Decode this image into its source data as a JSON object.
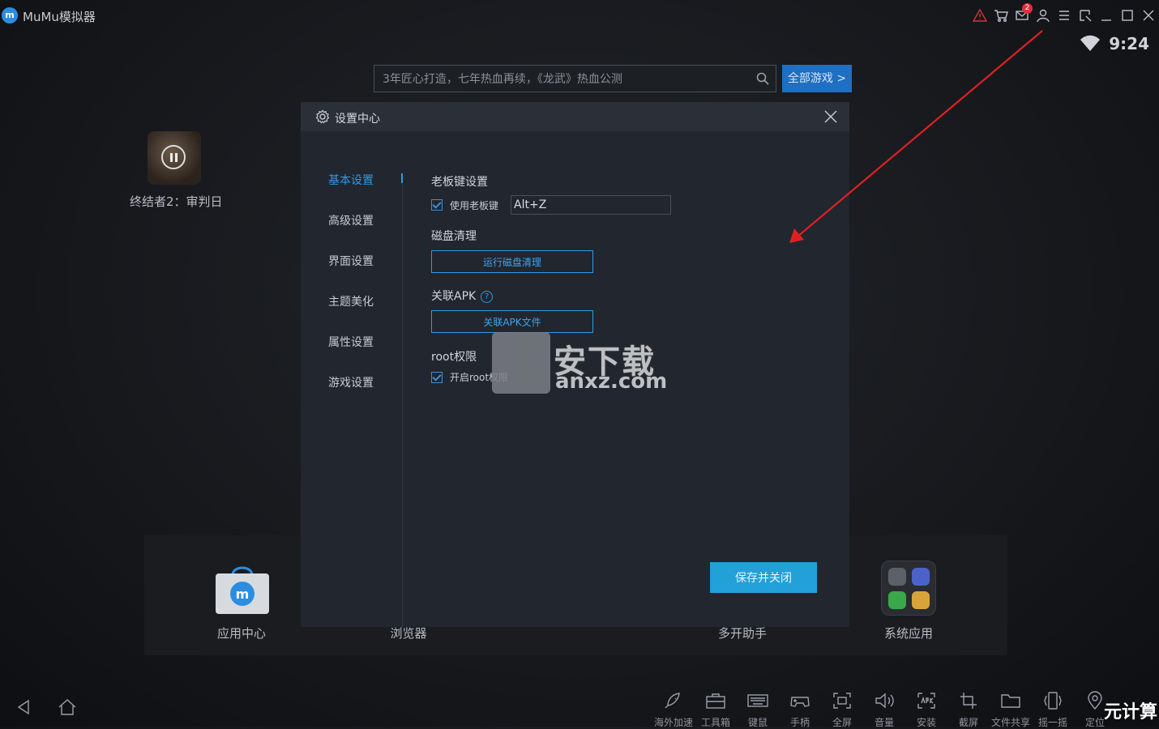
{
  "app": {
    "title": "MuMu模拟器",
    "logo_text": "m"
  },
  "titlebar": {
    "notification_count": "2"
  },
  "status": {
    "time": "9:24"
  },
  "search": {
    "placeholder": "3年匠心打造，七年热血再续，《龙武》热血公测",
    "all_games_label": "全部游戏 >"
  },
  "desktop": {
    "game_label": "终结者2：审判日"
  },
  "dock": {
    "items": [
      {
        "label": "应用中心"
      },
      {
        "label": "浏览器"
      },
      {
        "label": "多开助手"
      },
      {
        "label": "系统应用"
      }
    ]
  },
  "modal": {
    "title": "设置中心",
    "nav": [
      "基本设置",
      "高级设置",
      "界面设置",
      "主题美化",
      "属性设置",
      "游戏设置"
    ],
    "active_nav": "基本设置",
    "boss_key": {
      "title": "老板键设置",
      "checkbox_label": "使用老板键",
      "value": "Alt+Z"
    },
    "disk": {
      "title": "磁盘清理",
      "button": "运行磁盘清理"
    },
    "apk": {
      "title": "关联APK",
      "help": "?",
      "button": "关联APK文件"
    },
    "root": {
      "title": "root权限",
      "checkbox_label": "开启root权限"
    },
    "save_button": "保存并关闭"
  },
  "watermark": {
    "text": "安下载",
    "url": "anxz.com",
    "corner": "元计算"
  },
  "toolbar": {
    "tools": [
      "海外加速",
      "工具箱",
      "键鼠",
      "手柄",
      "全屏",
      "音量",
      "安装",
      "截屏",
      "文件共享",
      "摇一摇",
      "定位"
    ]
  },
  "colors": {
    "accent": "#2e9ae6",
    "save": "#22a0d8",
    "arrow": "#e02020"
  }
}
